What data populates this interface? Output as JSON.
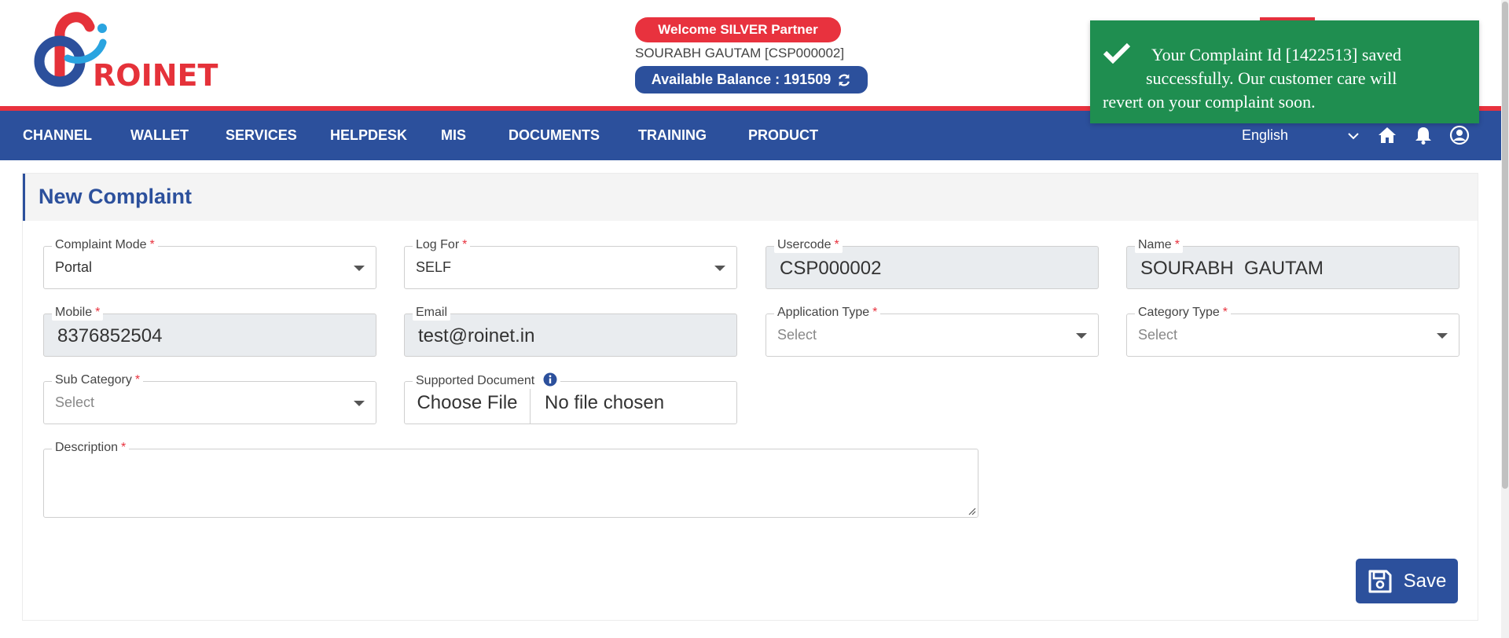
{
  "brand": {
    "logo_text": "ROINET"
  },
  "header": {
    "partner_badge": "Welcome SILVER Partner",
    "user_line": "SOURABH GAUTAM [CSP000002]",
    "balance": "Available Balance : 191509"
  },
  "nav": {
    "items": [
      "CHANNEL",
      "WALLET",
      "SERVICES",
      "HELPDESK",
      "MIS",
      "DOCUMENTS",
      "TRAINING",
      "PRODUCT"
    ],
    "language": "English"
  },
  "toast": {
    "line1": "Your Complaint Id [1422513] saved",
    "line2": "successfully. Our customer care will",
    "line3": "revert on your complaint soon."
  },
  "form": {
    "title": "New Complaint",
    "complaint_mode": {
      "label": "Complaint Mode",
      "value": "Portal"
    },
    "log_for": {
      "label": "Log For",
      "value": "SELF"
    },
    "usercode": {
      "label": "Usercode",
      "value": "CSP000002"
    },
    "name": {
      "label": "Name",
      "value": "SOURABH  GAUTAM"
    },
    "mobile": {
      "label": "Mobile",
      "value": "8376852504"
    },
    "email": {
      "label": "Email",
      "value": "test@roinet.in"
    },
    "application_type": {
      "label": "Application Type",
      "value": "Select"
    },
    "category_type": {
      "label": "Category Type",
      "value": "Select"
    },
    "sub_category": {
      "label": "Sub Category",
      "value": "Select"
    },
    "supported_document": {
      "label": "Supported Document",
      "button": "Choose File",
      "status": "No file chosen"
    },
    "description": {
      "label": "Description",
      "value": ""
    },
    "save_label": "Save",
    "required_marker": "*"
  },
  "colors": {
    "brand_blue": "#2c509c",
    "brand_red": "#e8323e",
    "toast_green": "#1f8e50"
  }
}
